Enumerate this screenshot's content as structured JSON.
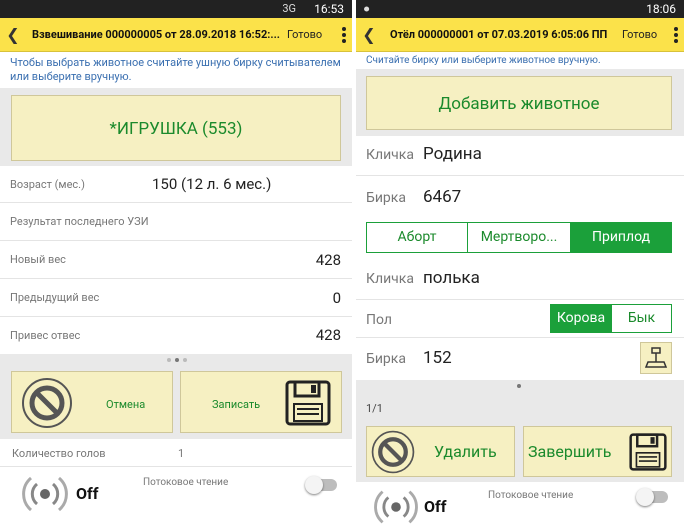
{
  "left": {
    "status": {
      "network": "3G",
      "time": "16:53"
    },
    "appbar": {
      "back_icon": "chevron-left-icon",
      "title": "Взвешивание 000000005 от 28.09.2018 16:52:...",
      "done": "Готово",
      "menu_icon": "more-vert-icon"
    },
    "hint": "Чтобы выбрать животное считайте ушную бирку считывателем или выберите вручную.",
    "animal_button": "*ИГРУШКА (553)",
    "fields": [
      {
        "label": "Возраст (мес.)",
        "value": "150 (12 л. 6 мес.)"
      },
      {
        "label": "Результат последнего УЗИ",
        "value": ""
      },
      {
        "label": "Новый вес",
        "value": "428"
      },
      {
        "label": "Предыдущий вес",
        "value": "0"
      },
      {
        "label": "Привес отвес",
        "value": "428"
      }
    ],
    "cancel_label": "Отмена",
    "save_label": "Записать",
    "heads_label": "Количество голов",
    "heads_value": "1",
    "off_label": "Off",
    "stream_label": "Потоковое чтение",
    "stream_on": false
  },
  "right": {
    "status": {
      "time": "18:06"
    },
    "appbar": {
      "back_icon": "chevron-left-icon",
      "title": "Отёл 000000001 от 07.03.2019 6:05:06 ПП",
      "done": "Готово",
      "menu_icon": "more-vert-icon"
    },
    "hint": "Считайте бирку или выберите животное вручную.",
    "add_animal": "Добавить животное",
    "mother": {
      "name_label": "Кличка",
      "name": "Родина",
      "tag_label": "Бирка",
      "tag": "6467"
    },
    "outcome_options": [
      "Аборт",
      "Мертворо...",
      "Приплод"
    ],
    "outcome_selected": 2,
    "calf": {
      "name_label": "Кличка",
      "name": "полька",
      "sex_label": "Пол",
      "sex_options": [
        "Корова",
        "Бык"
      ],
      "sex_selected": 0,
      "tag_label": "Бирка",
      "tag": "152"
    },
    "pager": "1/1",
    "delete_label": "Удалить",
    "finish_label": "Завершить",
    "off_label": "Off",
    "stream_label": "Потоковое чтение",
    "stream_on": false
  }
}
